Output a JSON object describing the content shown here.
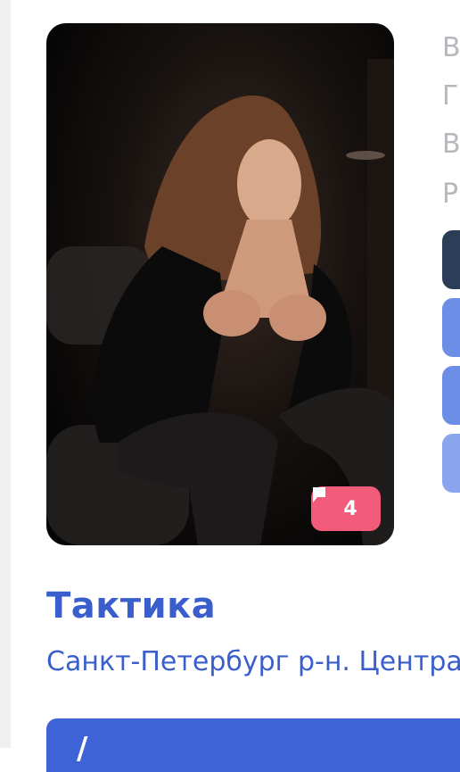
{
  "listing": {
    "title": "Тактика",
    "location": "Санкт-Петербург р-н. Центра",
    "comments_count": "4"
  },
  "side_specs": [
    "В",
    "Гр",
    "В",
    "Р"
  ],
  "side_buttons": [
    {
      "color": "#2c3e57"
    },
    {
      "color": "#6d8ee6"
    },
    {
      "color": "#6d8ee6"
    },
    {
      "color": "#8aa5ee"
    }
  ],
  "bottom_bar": {
    "glyph": "/"
  },
  "icons": {
    "comment": "comment-flag-icon"
  },
  "colors": {
    "accent": "#3a5fcc",
    "badge": "#f25b7a",
    "button_dark": "#2c3e57",
    "button_blue": "#3e63d6"
  }
}
